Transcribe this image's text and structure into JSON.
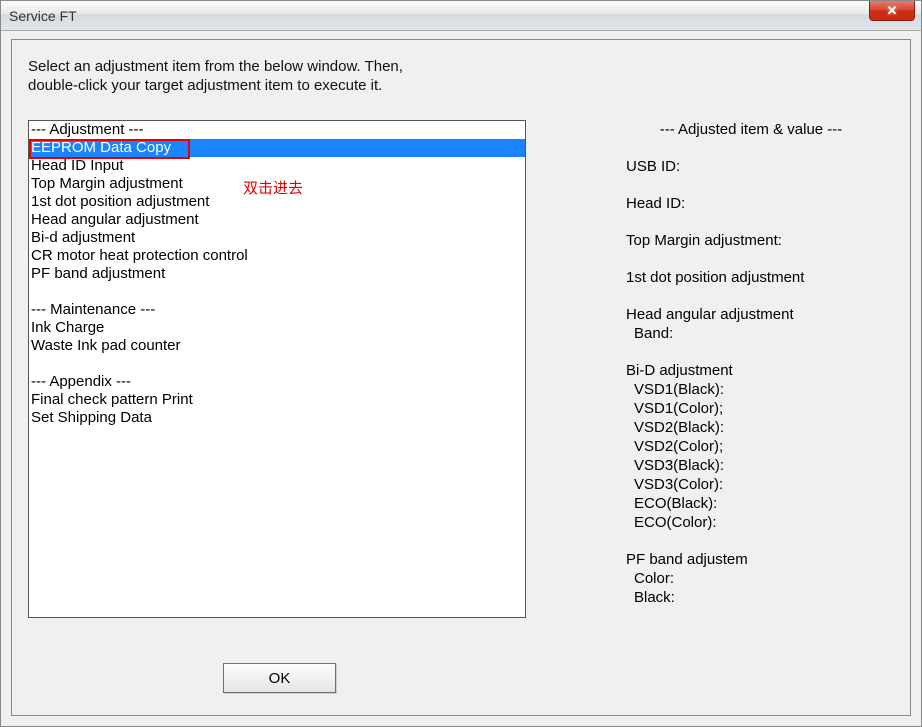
{
  "window": {
    "title": "Service FT"
  },
  "instruction": {
    "line1": "Select an adjustment item from the below window. Then,",
    "line2": "double-click your target adjustment item to execute it."
  },
  "listbox": {
    "items": [
      "--- Adjustment ---",
      "EEPROM Data Copy",
      "Head ID Input",
      "Top Margin adjustment",
      "1st dot position adjustment",
      "Head angular adjustment",
      "Bi-d adjustment",
      "CR motor heat protection control",
      "PF band adjustment",
      "",
      "--- Maintenance ---",
      "Ink Charge",
      "Waste Ink pad counter",
      "",
      "--- Appendix ---",
      "Final check pattern Print",
      "Set Shipping Data"
    ],
    "selected_index": 1
  },
  "annotation": {
    "text": "双击进去"
  },
  "info": {
    "title": "--- Adjusted item & value ---",
    "usb_id": "USB ID:",
    "head_id": "Head ID:",
    "top_margin": "Top Margin adjustment:",
    "first_dot": "1st dot position adjustment",
    "head_angular_label": "Head angular adjustment",
    "band": "Band:",
    "bid_label": "Bi-D adjustment",
    "vsd1_black": "VSD1(Black):",
    "vsd1_color": "VSD1(Color);",
    "vsd2_black": "VSD2(Black):",
    "vsd2_color": "VSD2(Color);",
    "vsd3_black": "VSD3(Black):",
    "vsd3_color": "VSD3(Color):",
    "eco_black": "ECO(Black):",
    "eco_color": "ECO(Color):",
    "pf_band_label": "PF band adjustem",
    "pf_color": "Color:",
    "pf_black": "Black:"
  },
  "buttons": {
    "ok": "OK"
  }
}
